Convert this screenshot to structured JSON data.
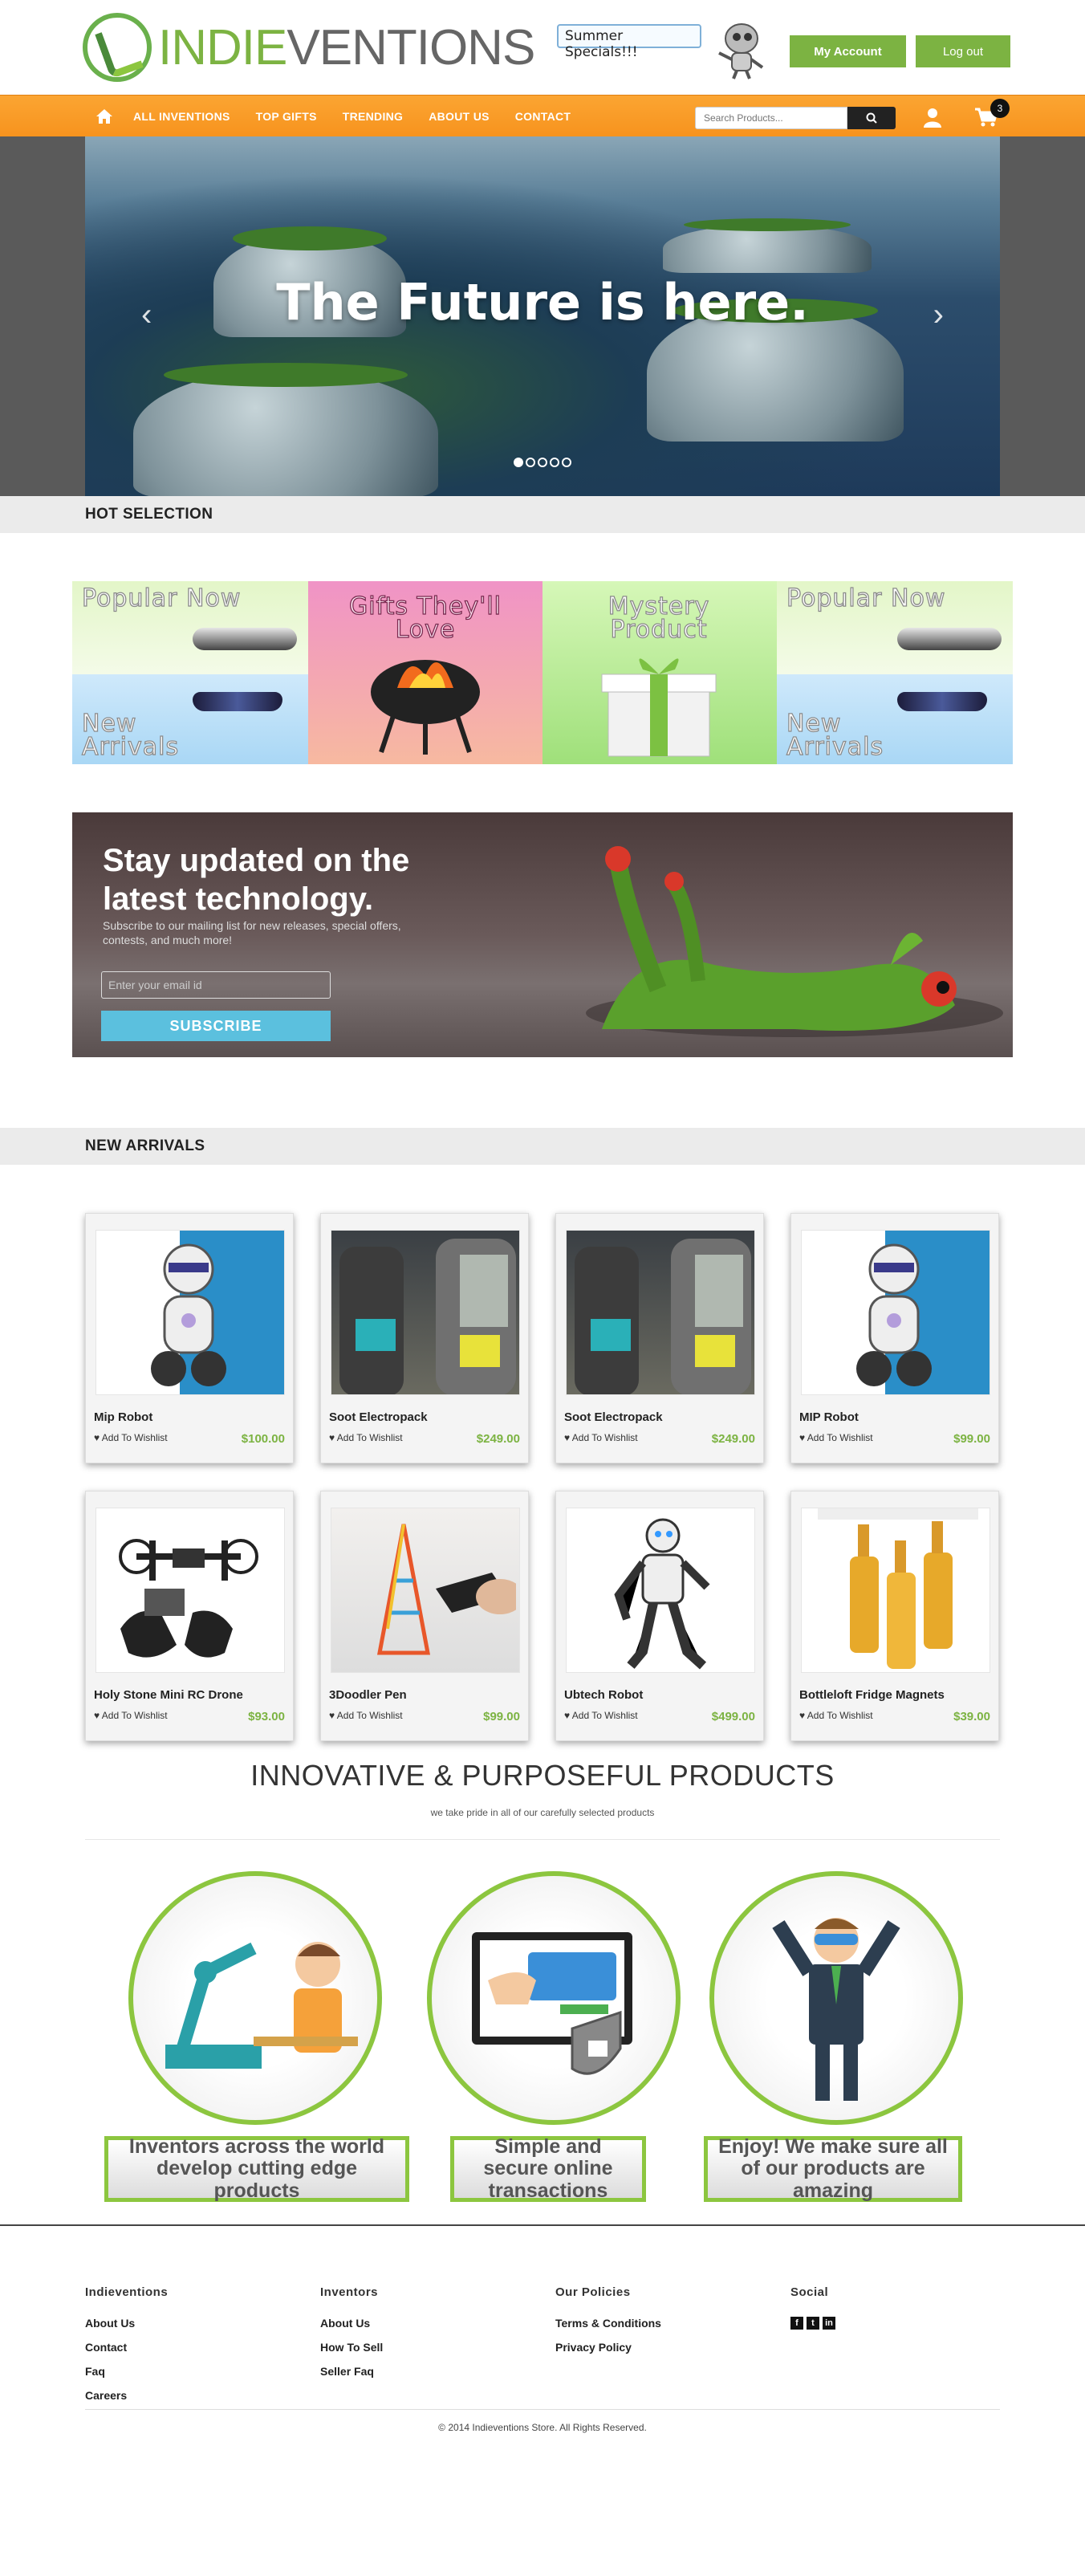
{
  "header": {
    "logo_part1": "INDIE",
    "logo_part2": "VENTIONS",
    "promo": "Summer Specials!!!",
    "my_account": "My Account",
    "logout": "Log out"
  },
  "nav": {
    "items": [
      "ALL INVENTIONS",
      "TOP GIFTS",
      "TRENDING",
      "ABOUT US",
      "CONTACT"
    ],
    "search_placeholder": "Search Products...",
    "cart_count": "3"
  },
  "hero": {
    "headline": "The Future is here.",
    "slides": 5,
    "active_slide": 1
  },
  "hot": {
    "title": "HOT SELECTION",
    "tiles": [
      "Popular Now",
      "New Arrivals",
      "Gifts They'll Love",
      "Mystery Product",
      "Popular Now",
      "New Arrivals"
    ]
  },
  "subscribe": {
    "title": "Stay updated on the latest technology.",
    "text": "Subscribe to our mailing list for new releases, special offers, contests, and much more!",
    "placeholder": "Enter your email id",
    "button": "SUBSCRIBE"
  },
  "arrivals": {
    "title": "NEW ARRIVALS",
    "wishlist": "Add To Wishlist",
    "products": [
      {
        "name": "Mip Robot",
        "price": "$100.00"
      },
      {
        "name": "Soot Electropack",
        "price": "$249.00"
      },
      {
        "name": "Soot Electropack",
        "price": "$249.00"
      },
      {
        "name": "MIP Robot",
        "price": "$99.00"
      },
      {
        "name": "Holy Stone Mini RC Drone",
        "price": "$93.00"
      },
      {
        "name": "3Doodler Pen",
        "price": "$99.00"
      },
      {
        "name": "Ubtech Robot",
        "price": "$499.00"
      },
      {
        "name": "Bottleloft Fridge Magnets",
        "price": "$39.00"
      }
    ]
  },
  "innovative": {
    "title": "INNOVATIVE & PURPOSEFUL PRODUCTS",
    "tagline": "we take pride in all of our carefully selected products",
    "captions": [
      "Inventors across the world develop cutting edge products",
      "Simple and secure online transactions",
      "Enjoy! We make sure all of our products are amazing"
    ]
  },
  "footer": {
    "col1": {
      "title": "Indieventions",
      "links": [
        "About Us",
        "Contact",
        "Faq",
        "Careers"
      ]
    },
    "col2": {
      "title": "Inventors",
      "links": [
        "About Us",
        "How To Sell",
        "Seller Faq"
      ]
    },
    "col3": {
      "title": "Our Policies",
      "links": [
        "Terms & Conditions",
        "Privacy Policy"
      ]
    },
    "col4": {
      "title": "Social",
      "icons": [
        "facebook-icon",
        "twitter-icon",
        "linkedin-icon"
      ]
    },
    "copyright": "© 2014 Indieventions Store. All Rights Reserved."
  },
  "colors": {
    "brand_green": "#7cb342",
    "nav_orange": "#f7931e",
    "price_green": "#7cb342",
    "subscribe_blue": "#5bc0de"
  }
}
